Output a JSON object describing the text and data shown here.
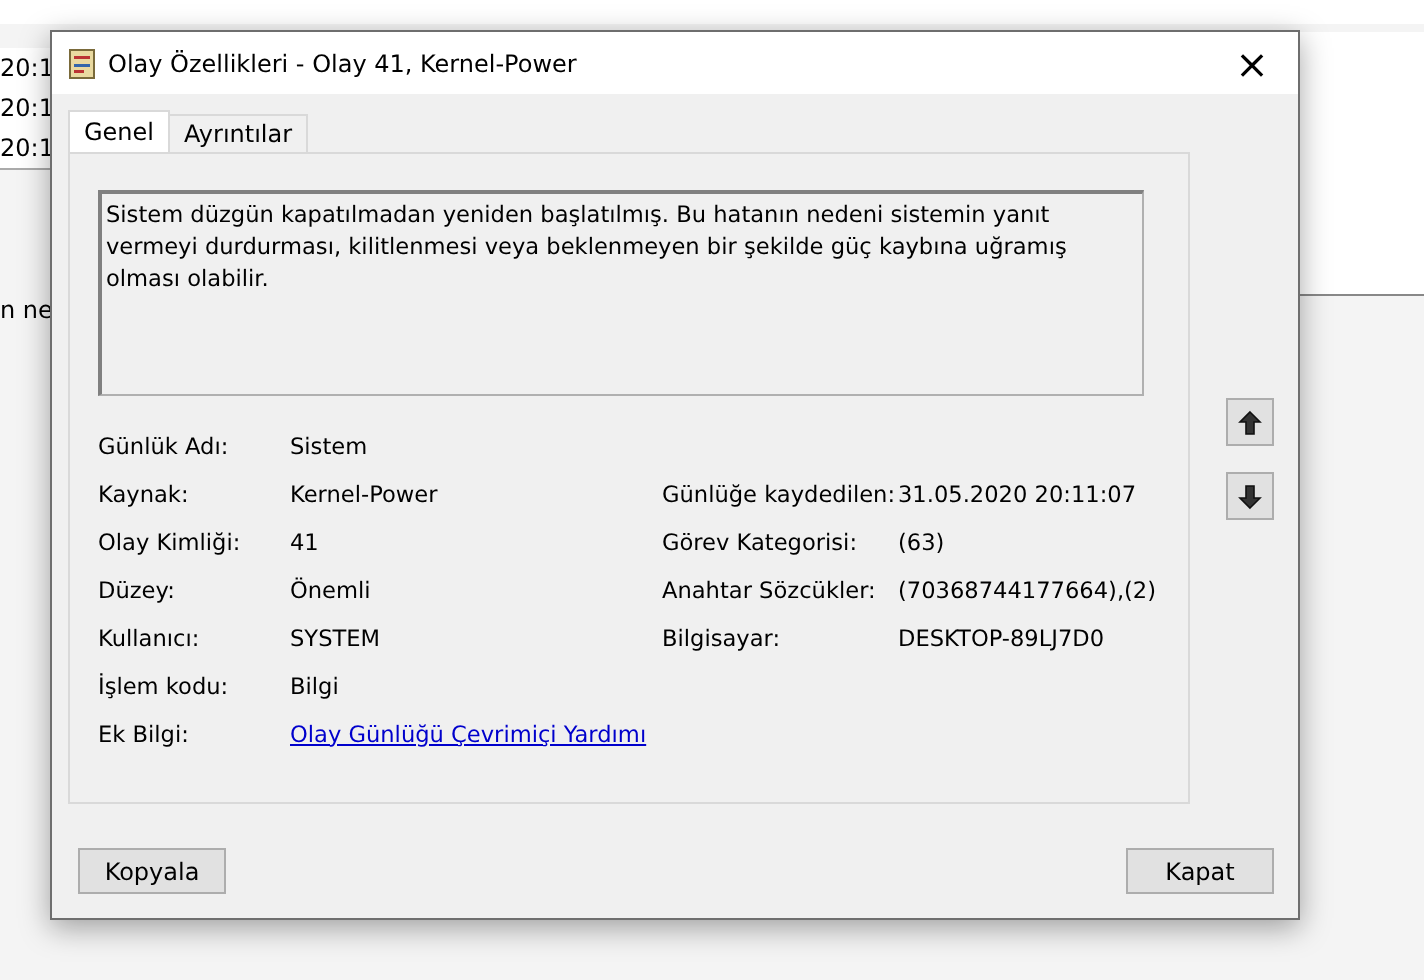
{
  "background": {
    "rows": [
      "20:1",
      "20:1",
      "20:1"
    ],
    "detail": "n ne"
  },
  "window": {
    "title": "Olay Özellikleri - Olay 41, Kernel-Power",
    "close": "×"
  },
  "tabs": [
    {
      "label": "Genel",
      "selected": true
    },
    {
      "label": "Ayrıntılar",
      "selected": false
    }
  ],
  "description": "Sistem düzgün kapatılmadan yeniden başlatılmış. Bu hatanın nedeni sistemin yanıt vermeyi durdurması, kilitlenmesi veya beklenmeyen bir şekilde güç kaybına uğramış olması olabilir.",
  "fields_left": [
    {
      "label": "Günlük Adı:",
      "value": "Sistem"
    },
    {
      "label": "Kaynak:",
      "value": "Kernel-Power"
    },
    {
      "label": "Olay Kimliği:",
      "value": "41"
    },
    {
      "label": "Düzey:",
      "value": "Önemli"
    },
    {
      "label": "Kullanıcı:",
      "value": "SYSTEM"
    },
    {
      "label": "İşlem kodu:",
      "value": "Bilgi"
    },
    {
      "label": "Ek Bilgi:",
      "value": "Olay Günlüğü Çevrimiçi Yardımı",
      "kind": "link"
    }
  ],
  "fields_right": [
    {
      "label": "Günlüğe kaydedilen:",
      "value": "31.05.2020 20:11:07"
    },
    {
      "label": "Görev Kategorisi:",
      "value": "(63)"
    },
    {
      "label": "Anahtar Sözcükler:",
      "value": "(70368744177664),(2)"
    },
    {
      "label": "Bilgisayar:",
      "value": "DESKTOP-89LJ7D0"
    }
  ],
  "buttons": [
    "Kopyala",
    "Kapat"
  ]
}
